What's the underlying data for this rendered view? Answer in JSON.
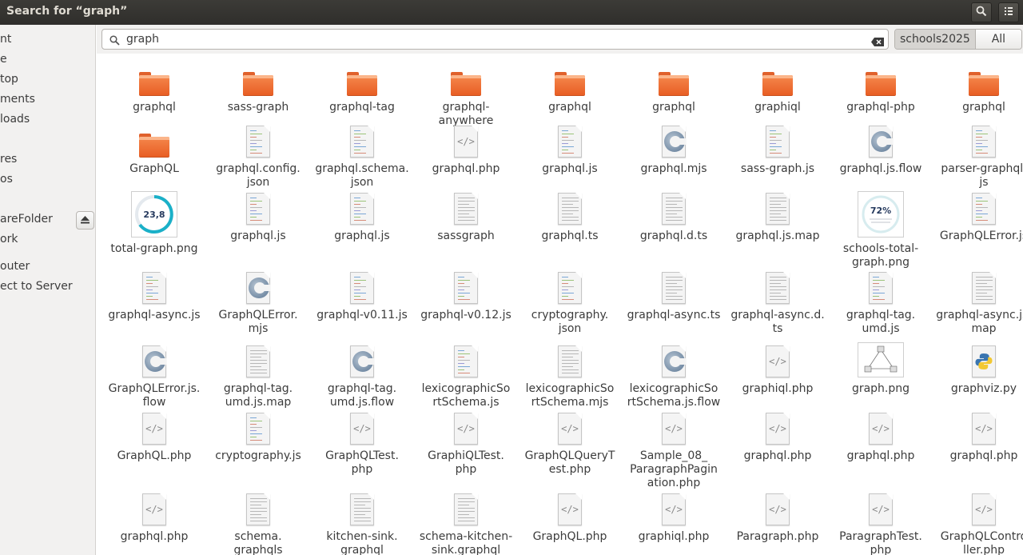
{
  "window": {
    "title": "Search for “graph”"
  },
  "titlebar": {
    "search_icon": "search-icon",
    "menu_icon": "menu-icon"
  },
  "sidebar": {
    "items": [
      {
        "label": "nt"
      },
      {
        "label": "e"
      },
      {
        "label": "top"
      },
      {
        "label": "ments"
      },
      {
        "label": "loads"
      },
      {
        "label": ""
      },
      {
        "label": "res"
      },
      {
        "label": "os"
      },
      {
        "label": "areFolder"
      },
      {
        "label": "ork"
      },
      {
        "label": "outer"
      },
      {
        "label": "ect to Server"
      }
    ]
  },
  "search": {
    "value": "graph",
    "placeholder": ""
  },
  "scope": {
    "active": "schools2025",
    "inactive": "All Files"
  },
  "thumbs": {
    "total_graph": "23,8",
    "schools_total": "72%"
  },
  "files": [
    {
      "name": "graphql",
      "type": "folder"
    },
    {
      "name": "sass-graph",
      "type": "folder"
    },
    {
      "name": "graphql-tag",
      "type": "folder"
    },
    {
      "name": "graphql-\nanywhere",
      "type": "folder"
    },
    {
      "name": "graphql",
      "type": "folder"
    },
    {
      "name": "graphql",
      "type": "folder"
    },
    {
      "name": "graphiql",
      "type": "folder"
    },
    {
      "name": "graphql-php",
      "type": "folder"
    },
    {
      "name": "graphql",
      "type": "folder"
    },
    {
      "name": "GraphQL",
      "type": "folder"
    },
    {
      "name": "graphql.config.\njson",
      "type": "code"
    },
    {
      "name": "graphql.schema.\njson",
      "type": "code"
    },
    {
      "name": "graphql.php",
      "type": "php"
    },
    {
      "name": "graphql.js",
      "type": "code"
    },
    {
      "name": "graphql.mjs",
      "type": "c"
    },
    {
      "name": "sass-graph.js",
      "type": "code"
    },
    {
      "name": "graphql.js.flow",
      "type": "c"
    },
    {
      "name": "parser-graphql.\njs",
      "type": "code"
    },
    {
      "name": "total-graph.png",
      "type": "thumb-blue"
    },
    {
      "name": "graphql.js",
      "type": "code"
    },
    {
      "name": "graphql.js",
      "type": "code"
    },
    {
      "name": "sassgraph",
      "type": "text"
    },
    {
      "name": "graphql.ts",
      "type": "text"
    },
    {
      "name": "graphql.d.ts",
      "type": "text"
    },
    {
      "name": "graphql.js.map",
      "type": "text"
    },
    {
      "name": "schools-total-\ngraph.png",
      "type": "thumb-72"
    },
    {
      "name": "GraphQLError.js",
      "type": "code"
    },
    {
      "name": "graphql-async.js",
      "type": "code"
    },
    {
      "name": "GraphQLError.\nmjs",
      "type": "c"
    },
    {
      "name": "graphql-v0.11.js",
      "type": "code"
    },
    {
      "name": "graphql-v0.12.js",
      "type": "code"
    },
    {
      "name": "cryptography.\njson",
      "type": "code"
    },
    {
      "name": "graphql-async.ts",
      "type": "text"
    },
    {
      "name": "graphql-async.d.\nts",
      "type": "text"
    },
    {
      "name": "graphql-tag.\numd.js",
      "type": "code"
    },
    {
      "name": "graphql-async.js.\nmap",
      "type": "text"
    },
    {
      "name": "GraphQLError.js.\nflow",
      "type": "c"
    },
    {
      "name": "graphql-tag.\numd.js.map",
      "type": "text"
    },
    {
      "name": "graphql-tag.\numd.js.flow",
      "type": "c"
    },
    {
      "name": "lexicographicSo\nrtSchema.js",
      "type": "code"
    },
    {
      "name": "lexicographicSo\nrtSchema.mjs",
      "type": "text"
    },
    {
      "name": "lexicographicSo\nrtSchema.js.flow",
      "type": "c"
    },
    {
      "name": "graphiql.php",
      "type": "php"
    },
    {
      "name": "graph.png",
      "type": "thumb-graph"
    },
    {
      "name": "graphviz.py",
      "type": "python"
    },
    {
      "name": "GraphQL.php",
      "type": "php"
    },
    {
      "name": "cryptography.js",
      "type": "code"
    },
    {
      "name": "GraphQLTest.\nphp",
      "type": "php"
    },
    {
      "name": "GraphiQLTest.\nphp",
      "type": "php"
    },
    {
      "name": "GraphQLQueryT\nest.php",
      "type": "php"
    },
    {
      "name": "Sample_08_\nParagraphPagin\nation.php",
      "type": "php"
    },
    {
      "name": "graphql.php",
      "type": "php"
    },
    {
      "name": "graphql.php",
      "type": "php"
    },
    {
      "name": "graphql.php",
      "type": "php"
    },
    {
      "name": "graphql.php",
      "type": "php"
    },
    {
      "name": "schema.\ngraphqls",
      "type": "text"
    },
    {
      "name": "kitchen-sink.\ngraphql",
      "type": "text"
    },
    {
      "name": "schema-kitchen-\nsink.graphql",
      "type": "text"
    },
    {
      "name": "GraphQL.php",
      "type": "php"
    },
    {
      "name": "graphiql.php",
      "type": "php"
    },
    {
      "name": "Paragraph.php",
      "type": "php"
    },
    {
      "name": "ParagraphTest.\nphp",
      "type": "php"
    },
    {
      "name": "GraphQLContro\nller.php",
      "type": "php"
    }
  ]
}
